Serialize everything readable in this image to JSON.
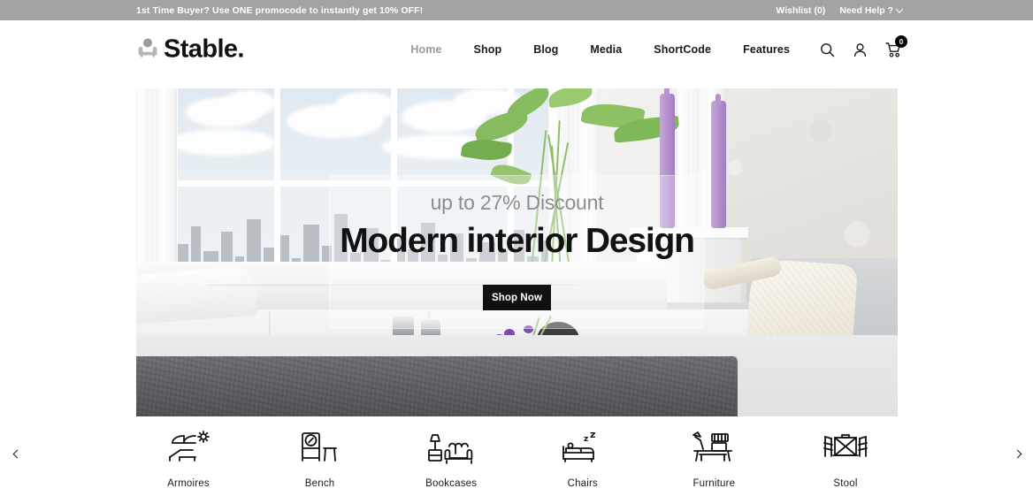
{
  "topbar": {
    "promo": "1st Time Buyer? Use ONE promocode to instantly get 10% OFF!",
    "wishlist": "Wishlist (0)",
    "help": "Need Help ?",
    "bg_color": "#a3a3a3",
    "text_color": "#ffffff"
  },
  "header": {
    "logo_text": "Stable.",
    "logo_icon": "armchair-icon",
    "nav": [
      {
        "label": "Home",
        "active": true
      },
      {
        "label": "Shop",
        "active": false
      },
      {
        "label": "Blog",
        "active": false
      },
      {
        "label": "Media",
        "active": false
      },
      {
        "label": "ShortCode",
        "active": false
      },
      {
        "label": "Features",
        "active": false
      }
    ],
    "icons": [
      {
        "name": "search-icon"
      },
      {
        "name": "account-icon"
      },
      {
        "name": "cart-icon",
        "badge": "0"
      }
    ]
  },
  "hero": {
    "subtitle": "up to 27% Discount",
    "title": "Modern interior Design",
    "button_label": "Shop Now",
    "button_bg": "#111111",
    "subtitle_color": "#8d8d8d",
    "title_color": "#111111",
    "scene": "modern white living room with sectional sofa, window city view, plant and purple vases"
  },
  "categories": {
    "prev_label": "Previous",
    "next_label": "Next",
    "items": [
      {
        "label": "Armoires",
        "icon": "lounger-sun-icon"
      },
      {
        "label": "Bench",
        "icon": "dresser-mirror-stool-icon"
      },
      {
        "label": "Bookcases",
        "icon": "lamp-sofa-icon"
      },
      {
        "label": "Chairs",
        "icon": "bed-sleep-icon"
      },
      {
        "label": "Furniture",
        "icon": "desk-lamp-shelf-icon"
      },
      {
        "label": "Stool",
        "icon": "table-chairs-icon"
      }
    ]
  }
}
